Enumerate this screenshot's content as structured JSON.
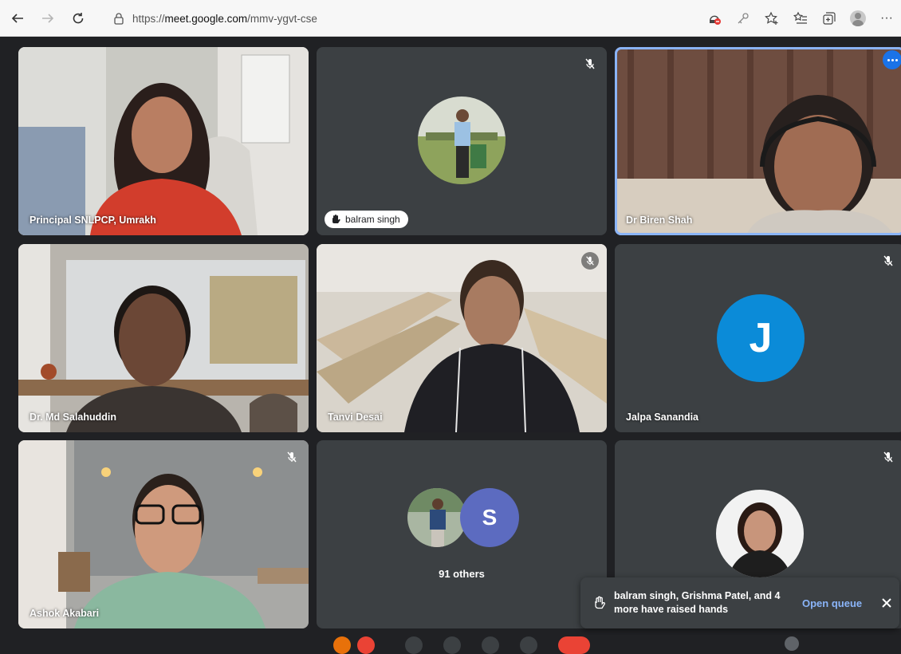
{
  "browser": {
    "url_scheme": "https://",
    "url_host": "meet.google.com",
    "url_path": "/mmv-ygvt-cse",
    "overflow_label": "···"
  },
  "tiles": [
    {
      "name": "Principal SNLPCP, Umrakh"
    },
    {
      "name": "balram singh"
    },
    {
      "name": "Dr Biren Shah"
    },
    {
      "name": "Dr. Md Salahuddin"
    },
    {
      "name": "Tanvi Desai"
    },
    {
      "name": "Jalpa Sanandia",
      "avatar_letter": "J"
    },
    {
      "name": "Ashok Akabari"
    },
    {
      "others_label": "91 others",
      "avatar_letter": "S"
    },
    {
      "name": ""
    }
  ],
  "colors": {
    "accent": "#1a73e8",
    "link": "#8ab4f8",
    "avatar_j": "#0b8bd8",
    "avatar_s": "#5c6bc0",
    "tile_bg": "#3c4043",
    "page_bg": "#202124"
  },
  "toast": {
    "message": "balram singh, Grishma Patel, and 4 more have raised hands",
    "action_label": "Open queue"
  }
}
